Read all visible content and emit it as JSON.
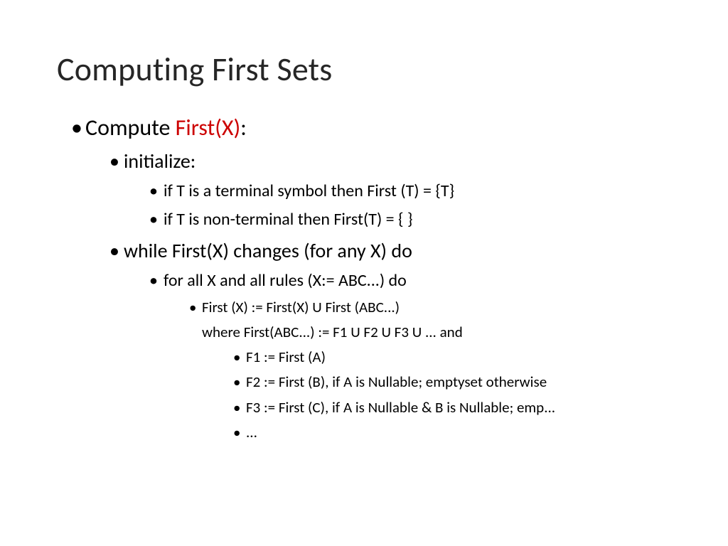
{
  "title": "Computing First Sets",
  "lvl1": {
    "compute_prefix": "Compute ",
    "compute_red": "First(X)",
    "compute_suffix": ":"
  },
  "lvl2": {
    "initialize": "initialize:",
    "while": "while First(X) changes (for any X) do"
  },
  "lvl3": {
    "init_terminal": "if T is a terminal symbol then First (T) = {T}",
    "init_nonterminal": "if T is non-terminal then First(T) = { }",
    "forall": "for all X and all rules (X:= ABC...) do"
  },
  "lvl4": {
    "firstx_union": "First (X) := First(X) U First (ABC...)",
    "where_clause": "where First(ABC...) := F1 U F2 U F3 U ... and"
  },
  "lvl5": {
    "f1": "F1 := First (A)",
    "f2": "F2 := First (B), if A is Nullable; emptyset otherwise",
    "f3": "F3 := First (C), if A is Nullable & B is Nullable; emp...",
    "dots": "..."
  }
}
